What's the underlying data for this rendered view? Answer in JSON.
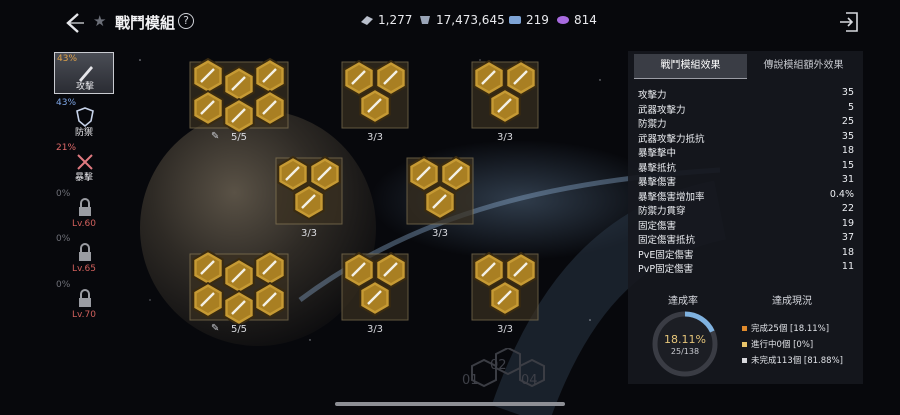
{
  "header": {
    "title": "戰鬥模組",
    "help": "?",
    "currencies": [
      {
        "icon": "crystal-icon",
        "value": "1,277"
      },
      {
        "icon": "gem-icon",
        "value": "17,473,645"
      },
      {
        "icon": "ticket-icon",
        "value": "219"
      },
      {
        "icon": "purple-token-icon",
        "value": "814"
      }
    ]
  },
  "categories": [
    {
      "percent": "43%",
      "label": "攻擊",
      "icon": "sword-icon",
      "active": true
    },
    {
      "percent": "43%",
      "label": "防禦",
      "icon": "shield-icon"
    },
    {
      "percent": "21%",
      "label": "暴擊",
      "icon": "crossed-swords-icon"
    },
    {
      "percent": "0%",
      "label": "Lv.60",
      "icon": "lock-icon"
    },
    {
      "percent": "0%",
      "label": "Lv.65",
      "icon": "lock-icon"
    },
    {
      "percent": "0%",
      "label": "Lv.70",
      "icon": "lock-icon"
    }
  ],
  "clusters": [
    {
      "label": "5/5",
      "pinned": true
    },
    {
      "label": "3/3"
    },
    {
      "label": "3/3"
    },
    {
      "label": "3/3"
    },
    {
      "label": "3/3"
    },
    {
      "label": "5/5",
      "pinned": true
    },
    {
      "label": "3/3"
    },
    {
      "label": "3/3"
    }
  ],
  "locked_cluster": {
    "slots": [
      "01",
      "02",
      "04"
    ]
  },
  "panel": {
    "tab_active": "戰鬥模組效果",
    "tab_inactive": "傳說模組額外效果",
    "stats": [
      {
        "name": "攻擊力",
        "value": "35"
      },
      {
        "name": "武器攻擊力",
        "value": "5"
      },
      {
        "name": "防禦力",
        "value": "25"
      },
      {
        "name": "武器攻擊力抵抗",
        "value": "35"
      },
      {
        "name": "暴擊擊中",
        "value": "18"
      },
      {
        "name": "暴擊抵抗",
        "value": "15"
      },
      {
        "name": "暴擊傷害",
        "value": "31"
      },
      {
        "name": "暴擊傷害增加率",
        "value": "0.4%"
      },
      {
        "name": "防禦力貫穿",
        "value": "22"
      },
      {
        "name": "固定傷害",
        "value": "19"
      },
      {
        "name": "固定傷害抵抗",
        "value": "37"
      },
      {
        "name": "PvE固定傷害",
        "value": "18"
      },
      {
        "name": "PvP固定傷害",
        "value": "11"
      }
    ],
    "progress": {
      "rate_title": "達成率",
      "status_title": "達成現況",
      "percent": "18.11%",
      "count": "25/138",
      "fraction": 0.1811,
      "legend": [
        {
          "text": "完成25個 [18.11%]",
          "color": "#e08a2c"
        },
        {
          "text": "進行中0個 [0%]",
          "color": "#e8c46a"
        },
        {
          "text": "未完成113個 [81.88%]",
          "color": "#d8d8dc"
        }
      ]
    }
  }
}
